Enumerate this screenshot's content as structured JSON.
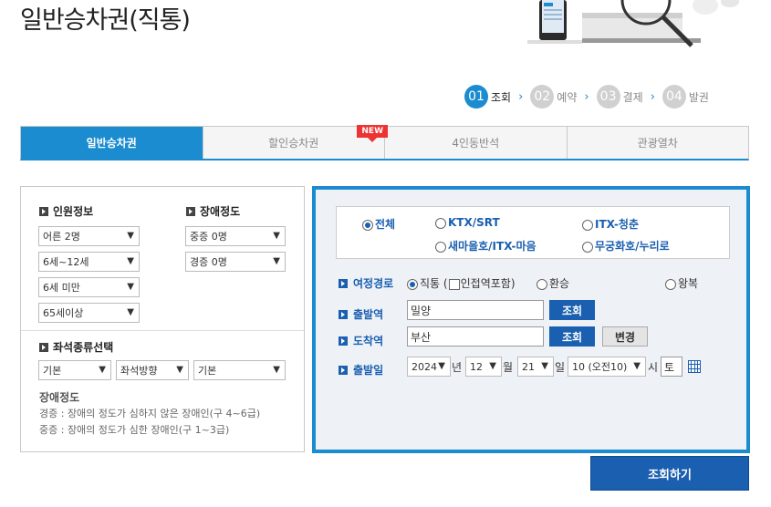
{
  "page_title": "일반승차권(직통)",
  "steps": [
    {
      "num": "01",
      "label": "조회",
      "active": true
    },
    {
      "num": "02",
      "label": "예약",
      "active": false
    },
    {
      "num": "03",
      "label": "결제",
      "active": false
    },
    {
      "num": "04",
      "label": "발권",
      "active": false
    }
  ],
  "tabs": [
    {
      "label": "일반승차권",
      "active": true
    },
    {
      "label": "할인승차권",
      "badge": "NEW"
    },
    {
      "label": "4인동반석"
    },
    {
      "label": "관광열차"
    }
  ],
  "passenger": {
    "heading": "인원정보",
    "adult": "어른 2명",
    "child": "6세~12세",
    "infant": "6세 미만",
    "senior": "65세이상"
  },
  "disability": {
    "heading": "장애정도",
    "severe": "중증 0명",
    "mild": "경증 0명"
  },
  "seat": {
    "heading": "좌석종류선택",
    "type": "기본",
    "direction": "좌석방향",
    "option": "기본"
  },
  "disability_note": {
    "heading": "장애정도",
    "mild_desc": "경증 : 장애의 정도가 심하지 않은 장애인(구 4~6급)",
    "severe_desc": "중증 : 장애의 정도가 심한 장애인(구 1~3급)"
  },
  "train_types": {
    "all": "전체",
    "ktx": "KTX/SRT",
    "itx_chungchun": "ITX-청춘",
    "saemaeul": "새마을호/ITX-마음",
    "mugunghwa": "무궁화호/누리로",
    "selected": "all"
  },
  "route": {
    "label": "여정경로",
    "direct": "직통",
    "paren_open": "(",
    "adjacent": "인접역포함",
    "paren_close": ")",
    "transfer": "환승",
    "roundtrip": "왕복"
  },
  "departure": {
    "label": "출발역",
    "value": "밀양",
    "search": "조회"
  },
  "arrival": {
    "label": "도착역",
    "value": "부산",
    "search": "조회",
    "swap": "변경"
  },
  "date": {
    "label": "출발일",
    "year": "2024",
    "year_unit": "년",
    "month": "12",
    "month_unit": "월",
    "day": "21",
    "day_unit": "일",
    "hour": "10 (오전10)",
    "hour_unit": "시",
    "weekday": "토"
  },
  "submit_label": "조회하기",
  "colors": {
    "accent": "#1a8ccf",
    "brand_dark": "#1a5fb0",
    "badge": "#e33333"
  }
}
